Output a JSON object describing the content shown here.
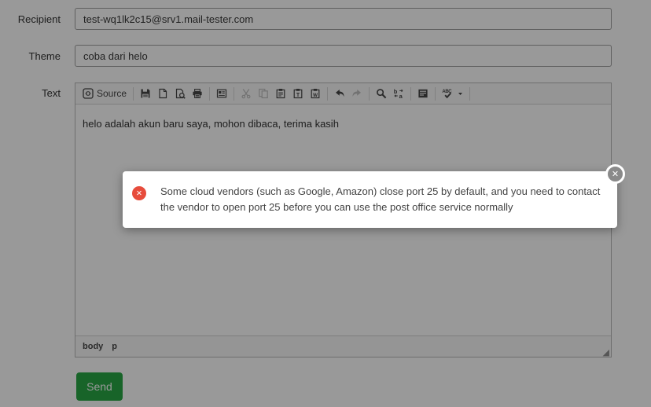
{
  "form": {
    "recipient": {
      "label": "Recipient",
      "value": "test-wq1lk2c15@srv1.mail-tester.com"
    },
    "theme": {
      "label": "Theme",
      "value": "coba dari helo"
    },
    "text_label": "Text",
    "send_button": "Send"
  },
  "editor": {
    "source_button_label": "Source",
    "toolbar_buttons": [
      "source",
      "save",
      "new-page",
      "preview",
      "print",
      "templates",
      "cut",
      "copy",
      "paste",
      "paste-plain-text",
      "paste-from-word",
      "undo",
      "redo",
      "find",
      "replace",
      "select-all",
      "spell-check"
    ],
    "disabled_buttons": [
      "cut",
      "copy",
      "redo"
    ],
    "content_text": "helo adalah akun baru saya, mohon dibaca, terima kasih",
    "element_path": [
      "body",
      "p"
    ]
  },
  "modal": {
    "message": "Some cloud vendors (such as Google, Amazon) close port 25 by default, and you need to contact the vendor to open port 25 before you can use the post office service normally",
    "error_glyph": "✕",
    "close_glyph": "✕"
  },
  "icons": {
    "source-icon": "code brackets in rounded square",
    "save-icon": "floppy disk",
    "new-page-icon": "blank document with folded corner",
    "preview-icon": "document with magnifier",
    "print-icon": "printer",
    "templates-icon": "document layout template",
    "cut-icon": "scissors",
    "copy-icon": "two overlapping documents",
    "paste-icon": "clipboard",
    "paste-text-icon": "clipboard with T",
    "paste-word-icon": "clipboard with W",
    "undo-icon": "curved arrow left",
    "redo-icon": "curved arrow right",
    "find-icon": "magnifier",
    "replace-icon": "b and a with swap arrows",
    "select-all-icon": "filled text block",
    "spell-check-icon": "ABC over checkmark",
    "dropdown-caret-icon": "▾",
    "close-icon": "✕",
    "error-icon": "✕ in red circle",
    "resize-handle-icon": "◢"
  },
  "colors": {
    "send_button_green": "#28a745",
    "error_red": "#e74c3c",
    "overlay": "rgba(0,0,0,0.40)"
  }
}
